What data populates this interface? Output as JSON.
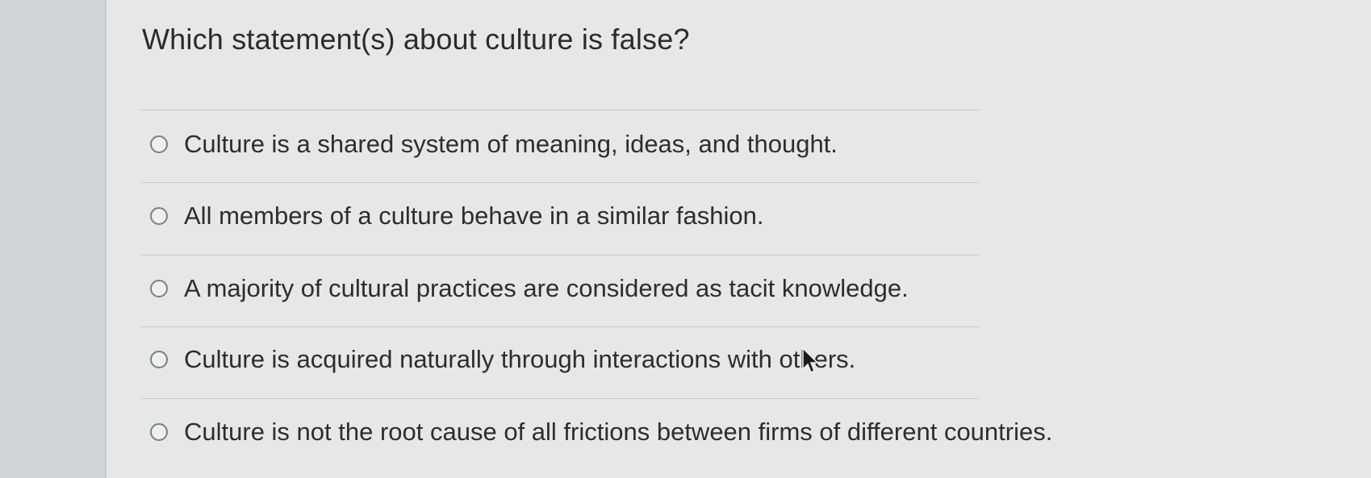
{
  "question": {
    "text": "Which statement(s) about culture is false?"
  },
  "options": [
    {
      "label": "Culture is a shared system of meaning, ideas, and thought.",
      "selected": false
    },
    {
      "label": "All members of a culture behave in a similar fashion.",
      "selected": false
    },
    {
      "label": "A majority of cultural practices are considered as tacit knowledge.",
      "selected": false
    },
    {
      "label": "Culture is acquired naturally through interactions with others.",
      "selected": false
    },
    {
      "label": "Culture is not the root cause of all frictions between firms of different countries.",
      "selected": false
    }
  ],
  "icons": {
    "radio": "radio-button-icon",
    "cursor": "mouse-pointer-icon"
  },
  "colors": {
    "card_background": "#e6e8e8",
    "page_background": "#d7dcdc",
    "text": "#2d2d2d",
    "radio_border": "#7a7f82"
  }
}
